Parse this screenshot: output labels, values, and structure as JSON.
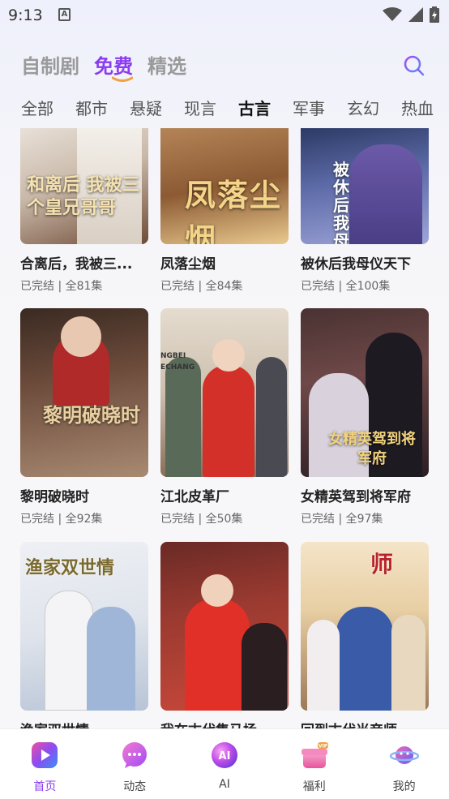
{
  "status": {
    "time": "9:13",
    "a_icon": "A"
  },
  "top_tabs": [
    "自制剧",
    "免费",
    "精选"
  ],
  "categories": [
    "全部",
    "都市",
    "悬疑",
    "现言",
    "古言",
    "军事",
    "玄幻",
    "热血"
  ],
  "cards": [
    {
      "title": "合离后，我被三...",
      "meta": "已完结 | 全81集",
      "poster_text": "和离后 我被三个皇兄哥哥"
    },
    {
      "title": "凤落尘烟",
      "meta": "已完结 | 全84集",
      "poster_text": "凤落尘烟"
    },
    {
      "title": "被休后我母仪天下",
      "meta": "已完结 | 全100集",
      "poster_text": "被休后我母仪天"
    },
    {
      "title": "黎明破晓时",
      "meta": "已完结 | 全92集",
      "poster_text": "黎明破晓时"
    },
    {
      "title": "江北皮革厂",
      "meta": "已完结 | 全50集",
      "poster_text": "NGBEI ECHANG"
    },
    {
      "title": "女精英驾到将军府",
      "meta": "已完结 | 全97集",
      "poster_text": "女精英驾到将军府"
    },
    {
      "title": "渔家双世情",
      "meta": "",
      "poster_text": "渔家双世情"
    },
    {
      "title": "我在古代集马场",
      "meta": "",
      "poster_text": ""
    },
    {
      "title": "回到古代当帝师",
      "meta": "",
      "poster_text": "师"
    }
  ],
  "nav": [
    {
      "label": "首页",
      "icon": "home-play-icon"
    },
    {
      "label": "动态",
      "icon": "chat-bubble-icon"
    },
    {
      "label": "AI",
      "icon": "ai-orb-icon"
    },
    {
      "label": "福利",
      "icon": "gift-vip-icon"
    },
    {
      "label": "我的",
      "icon": "planet-profile-icon"
    }
  ],
  "colors": {
    "accent": "#8a3cf0",
    "accent_orange": "#f0a040"
  }
}
